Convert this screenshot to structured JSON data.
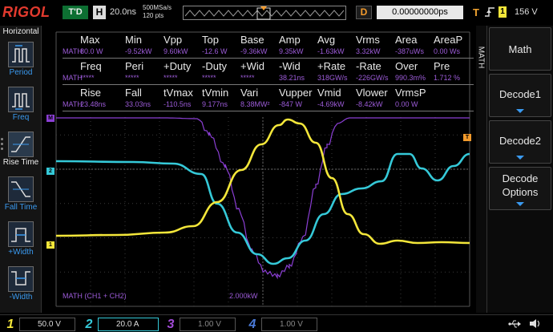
{
  "brand": "RIGOL",
  "topbar": {
    "trigger_state": "T'D",
    "timebase_key": "H",
    "timebase": "20.0ns",
    "sample_rate": "500MSa/s",
    "memory_depth": "120 pts",
    "delay_key": "D",
    "delay": "0.00000000ps",
    "trigger_key": "T",
    "trigger_channel": "1",
    "trigger_level": "156 V"
  },
  "left_panel": {
    "title": "Horizontal",
    "items": [
      {
        "label": "Period",
        "icon": "period-icon"
      },
      {
        "label": "Freq",
        "icon": "freq-icon"
      },
      {
        "label": "Rise Time",
        "icon": "rise-time-icon"
      },
      {
        "label": "Fall Time",
        "icon": "fall-time-icon"
      },
      {
        "label": "+Width",
        "icon": "pos-width-icon"
      },
      {
        "label": "-Width",
        "icon": "neg-width-icon"
      }
    ]
  },
  "measurements": {
    "source": "MATH",
    "row1": {
      "headers": [
        "Max",
        "Min",
        "Vpp",
        "Top",
        "Base",
        "Amp",
        "Avg",
        "Vrms",
        "Area",
        "AreaP"
      ],
      "values": [
        "80.0 W",
        "-9.52kW",
        "9.60kW",
        "-12.6 W",
        "-9.36kW",
        "9.35kW",
        "-1.63kW",
        "3.32kW",
        "-387uWs",
        "0.00 Ws"
      ]
    },
    "row2": {
      "headers": [
        "Freq",
        "Peri",
        "+Duty",
        "-Duty",
        "+Wid",
        "-Wid",
        "+Rate",
        "-Rate",
        "Over",
        "Pre"
      ],
      "values": [
        "*****",
        "*****",
        "*****",
        "*****",
        "*****",
        "38.21ns",
        "318GW/s",
        "-226GW/s",
        "990.3m%",
        "1.712 %"
      ]
    },
    "row3": {
      "headers": [
        "Rise",
        "Fall",
        "tVmax",
        "tVmin",
        "Vari",
        "Vupper",
        "Vmid",
        "Vlower",
        "VrmsP"
      ],
      "values": [
        "23.48ns",
        "33.03ns",
        "-110.5ns",
        "9.177ns",
        "8.38MW²",
        "-847 W",
        "-4.69kW",
        "-8.42kW",
        "0.00 W"
      ]
    }
  },
  "waveform": {
    "math_expression": "MATH  (CH1 + CH2)",
    "math_scale": "2.000kW",
    "markers": {
      "math": "M",
      "ch1": "1",
      "ch2": "2",
      "trigger": "T"
    },
    "colors": {
      "ch1": "#f3e63a",
      "ch2": "#35c9d8",
      "math": "#8b3fd4",
      "grid": "#3a3a3a"
    }
  },
  "right_menu": {
    "title": "MATH",
    "buttons": [
      {
        "label": "Math",
        "has_arrow": false
      },
      {
        "label": "Decode1",
        "has_arrow": true
      },
      {
        "label": "Decode2",
        "has_arrow": true
      },
      {
        "label": "Decode Options",
        "has_arrow": true
      }
    ]
  },
  "bottom_bar": {
    "channels": [
      {
        "num": "1",
        "value": "50.0 V",
        "color": "#f3e63a"
      },
      {
        "num": "2",
        "value": "20.0 A",
        "color": "#35c9d8"
      },
      {
        "num": "3",
        "value": "1.00 V",
        "color": "#a24bd8"
      },
      {
        "num": "4",
        "value": "1.00 V",
        "color": "#4a7ad8"
      }
    ]
  }
}
